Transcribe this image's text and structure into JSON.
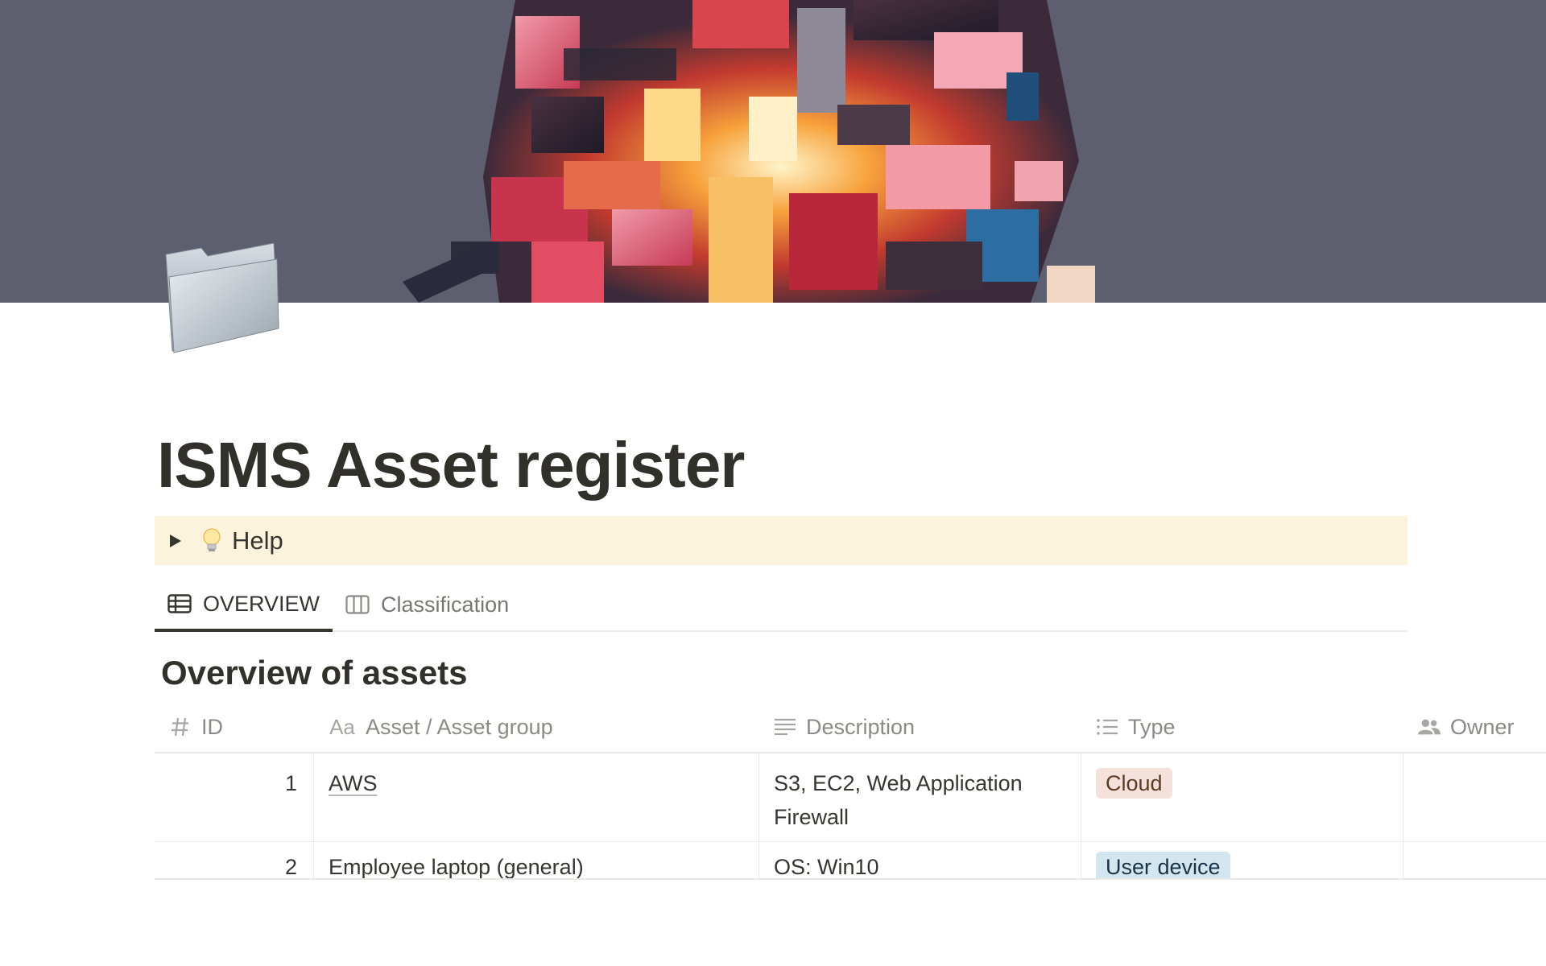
{
  "page": {
    "title": "ISMS Asset register",
    "icon": "folder-icon"
  },
  "cover": {
    "background_color": "#5d5f6e"
  },
  "callout": {
    "icon": "lightbulb-icon",
    "label": "Help",
    "background_color": "#fbf3db"
  },
  "tabs": [
    {
      "label": "OVERVIEW",
      "icon": "table-icon",
      "active": true
    },
    {
      "label": "Classification",
      "icon": "board-icon",
      "active": false
    }
  ],
  "database": {
    "title": "Overview of assets",
    "columns": [
      {
        "label": "ID",
        "icon": "number-icon"
      },
      {
        "label": "Asset / Asset group",
        "icon": "text-aa-icon"
      },
      {
        "label": "Description",
        "icon": "lines-icon"
      },
      {
        "label": "Type",
        "icon": "list-icon"
      },
      {
        "label": "Owner",
        "icon": "people-icon"
      }
    ],
    "rows": [
      {
        "id": "1",
        "asset": "AWS",
        "description": "S3, EC2, Web Application Firewall",
        "type": {
          "label": "Cloud",
          "bg": "#f4e1da",
          "color": "#5c3b23"
        },
        "owner": ""
      },
      {
        "id": "2",
        "asset": "Employee laptop (general)",
        "description": "OS: Win10",
        "type": {
          "label": "User device",
          "bg": "#d3e5ef",
          "color": "#183347"
        },
        "owner": ""
      }
    ]
  }
}
